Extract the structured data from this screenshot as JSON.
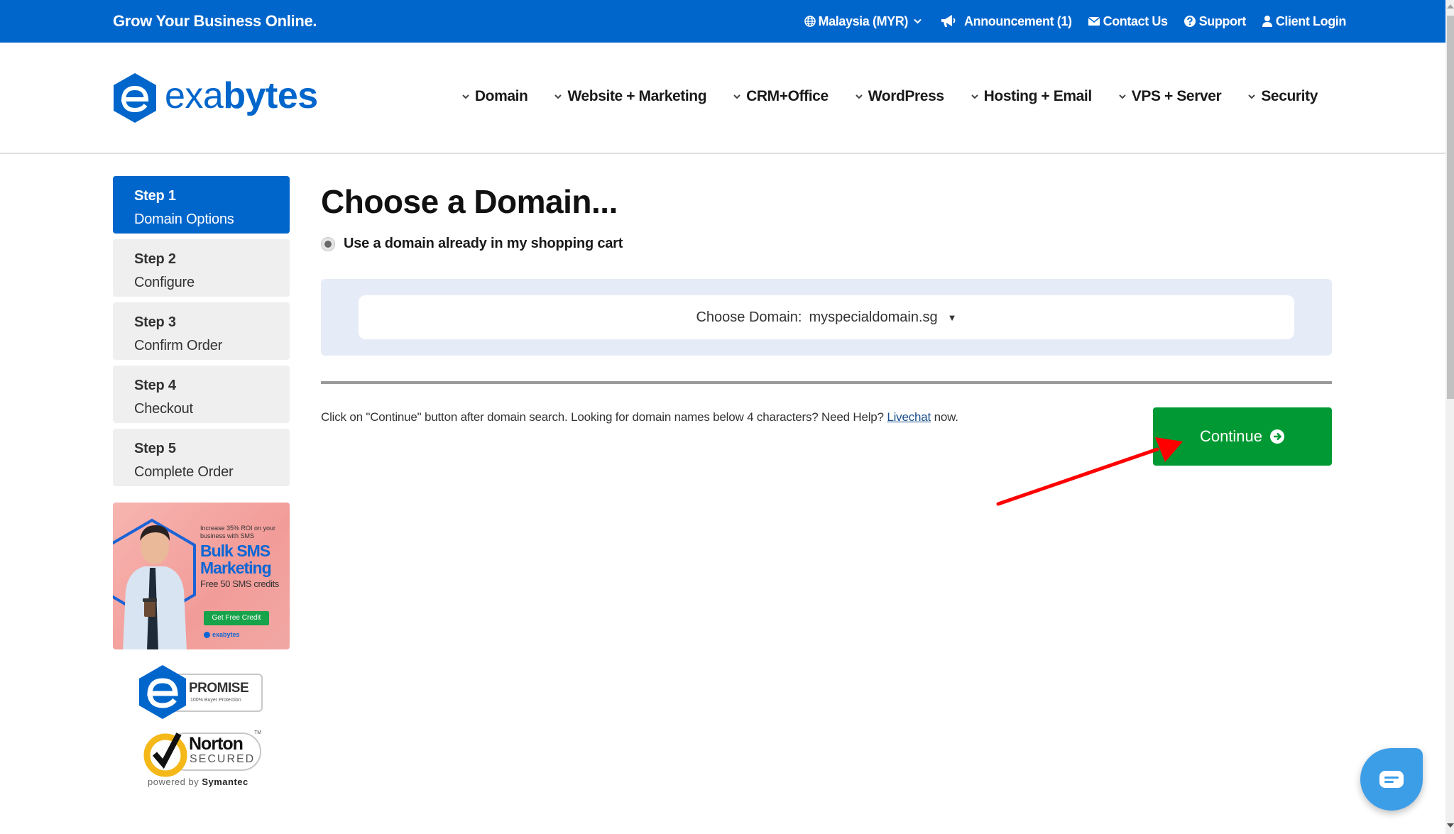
{
  "topbar": {
    "tagline": "Grow Your Business Online.",
    "links": {
      "region": "Malaysia (MYR)",
      "announcement": "Announcement (1)",
      "contact": "Contact Us",
      "support": "Support",
      "login": "Client Login"
    },
    "icons": {
      "region": "globe-icon",
      "announcement": "megaphone-icon",
      "contact": "envelope-icon",
      "support": "question-circle-icon",
      "login": "user-icon"
    }
  },
  "header": {
    "logo": {
      "prefix": "exa",
      "suffix": "bytes"
    },
    "nav": [
      {
        "label": "Domain"
      },
      {
        "label": "Website + Marketing"
      },
      {
        "label": "CRM+Office"
      },
      {
        "label": "WordPress"
      },
      {
        "label": "Hosting + Email"
      },
      {
        "label": "VPS + Server"
      },
      {
        "label": "Security"
      }
    ]
  },
  "sidebar": {
    "steps": [
      {
        "num": "Step 1",
        "label": "Domain Options",
        "active": true
      },
      {
        "num": "Step 2",
        "label": "Configure",
        "active": false
      },
      {
        "num": "Step 3",
        "label": "Confirm Order",
        "active": false
      },
      {
        "num": "Step 4",
        "label": "Checkout",
        "active": false
      },
      {
        "num": "Step 5",
        "label": "Complete Order",
        "active": false
      }
    ],
    "ad": {
      "small": "Increase 35% ROI on your business with SMS",
      "title": "Bulk SMS Marketing",
      "sub": "Free 50 SMS credits",
      "cta": "Get Free Credit",
      "brand": "exabytes"
    },
    "promise_badge": {
      "title": "PROMISE",
      "sub": "100% Buyer Protection"
    },
    "norton_badge": {
      "title": "Norton",
      "sub": "SECURED",
      "tm": "TM",
      "powered_prefix": "powered by ",
      "powered_brand": "Symantec"
    }
  },
  "main": {
    "title": "Choose a Domain...",
    "radio_label": "Use a domain already in my shopping cart",
    "radio_selected": true,
    "domain_select": {
      "label": "Choose Domain:",
      "value": "myspecialdomain.sg",
      "arrow": "▼"
    },
    "help": {
      "before": "Click on \"Continue\" button after domain search. Looking for domain names below 4 characters? Need Help? ",
      "link": "Livechat",
      "after": " now."
    },
    "continue_label": "Continue"
  },
  "colors": {
    "brand_blue": "#0066cc",
    "continue_green": "#009933",
    "panel_bg": "#e6ecf7",
    "step_inactive": "#efefef",
    "annotation_red": "#ff0000",
    "chat_blue": "#3d9ee8"
  }
}
